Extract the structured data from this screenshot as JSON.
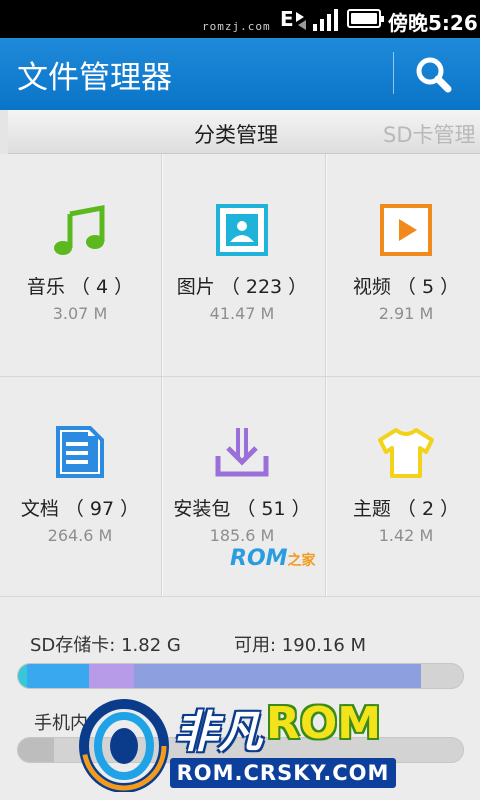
{
  "status_bar": {
    "watermark": "romzj.com",
    "network": "E",
    "time": "傍晚5:26"
  },
  "header": {
    "title": "文件管理器",
    "search_icon": "search-icon"
  },
  "tabs": [
    {
      "label": "分类管理",
      "active": true
    },
    {
      "label": "SD卡管理",
      "active": false
    }
  ],
  "categories": [
    {
      "label": "音乐 （ 4 ）",
      "size": "3.07 M",
      "icon": "music-note-icon",
      "color": "#5bb81e"
    },
    {
      "label": "图片 （ 223 ）",
      "size": "41.47 M",
      "icon": "picture-icon",
      "color": "#1fb3d9"
    },
    {
      "label": "视频 （ 5 ）",
      "size": "2.91 M",
      "icon": "video-play-icon",
      "color": "#f08a1c"
    },
    {
      "label": "文档 （ 97 ）",
      "size": "264.6 M",
      "icon": "document-icon",
      "color": "#2b8be0"
    },
    {
      "label": "安装包 （ 51 ）",
      "size": "185.6 M",
      "icon": "download-install-icon",
      "color": "#9a6fd9"
    },
    {
      "label": "主题 （ 2 ）",
      "size": "1.42 M",
      "icon": "tshirt-theme-icon",
      "color": "#f2d21a"
    }
  ],
  "watermark_center": {
    "rom": "ROM",
    "home": "之家"
  },
  "storage": {
    "sd_label": "SD存储卡: 1.82 G",
    "sd_available": "可用: 190.16 M",
    "sd_bar_segments": [
      {
        "fraction": 0.02,
        "color": "#38c7d9"
      },
      {
        "fraction": 0.14,
        "color": "#3aa8ee"
      },
      {
        "fraction": 0.1,
        "color": "#b79be8"
      },
      {
        "fraction": 0.645,
        "color": "#8e9fe0"
      }
    ],
    "phone_label": "手机内",
    "phone_bar_segments": [
      {
        "fraction": 0.08,
        "color": "#bdbdbd"
      }
    ]
  },
  "logo": {
    "brand_cn": "非凡",
    "brand_rom": "ROM",
    "url": "ROM.CRSKY.COM"
  }
}
